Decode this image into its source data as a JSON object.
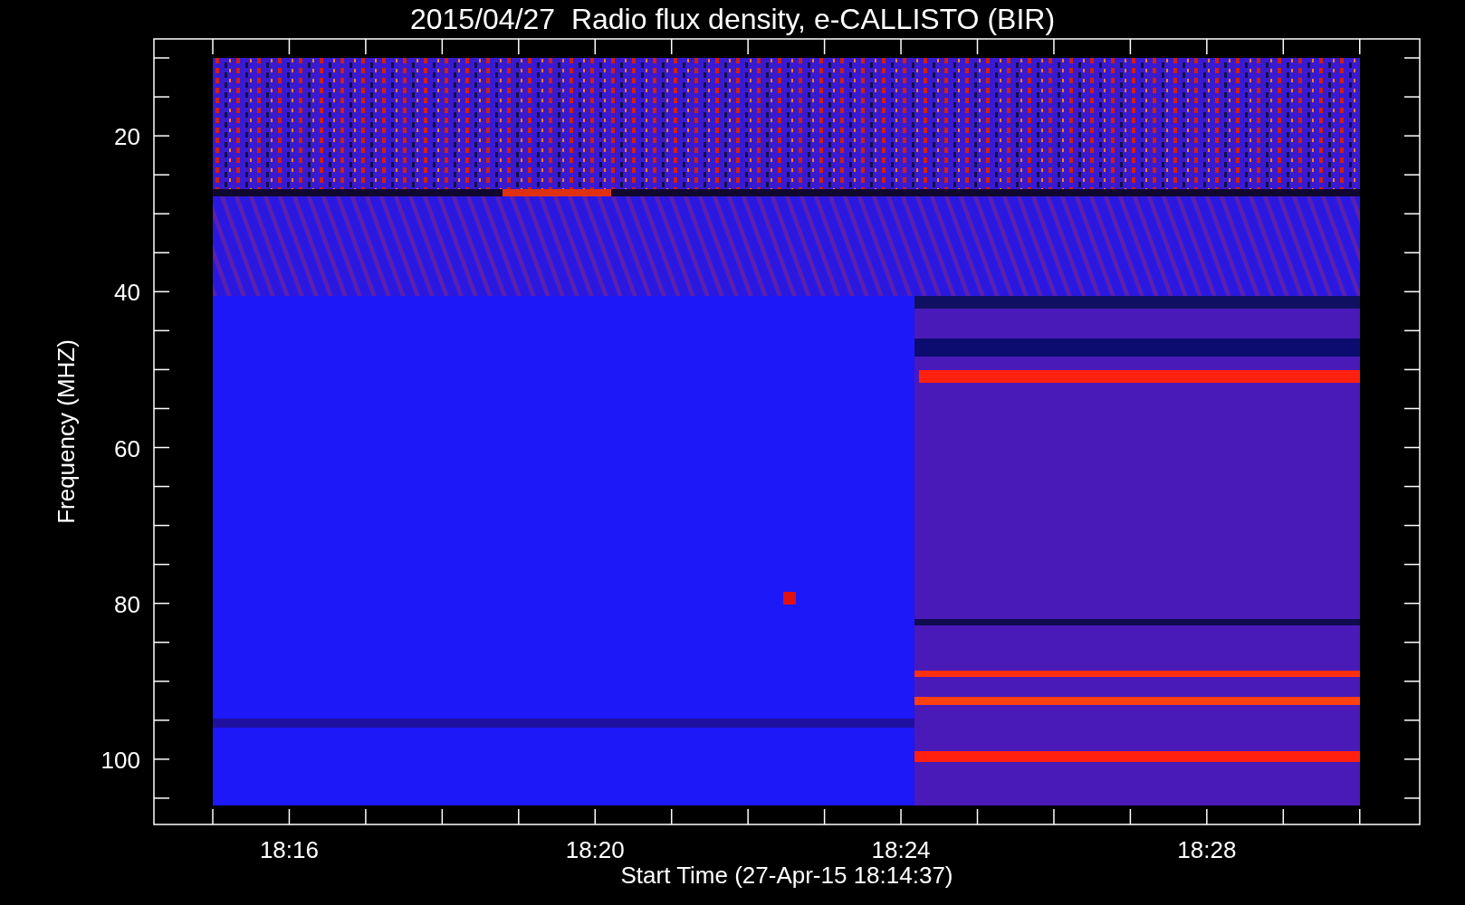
{
  "title": "2015/04/27  Radio flux density, e-CALLISTO (BIR)",
  "y_axis": {
    "label": "Frequency (MHZ)",
    "ticks": [
      "20",
      "40",
      "60",
      "80",
      "100"
    ]
  },
  "x_axis": {
    "label": "Start Time (27-Apr-15 18:14:37)",
    "ticks": [
      "18:16",
      "18:20",
      "18:24",
      "18:28"
    ]
  }
}
